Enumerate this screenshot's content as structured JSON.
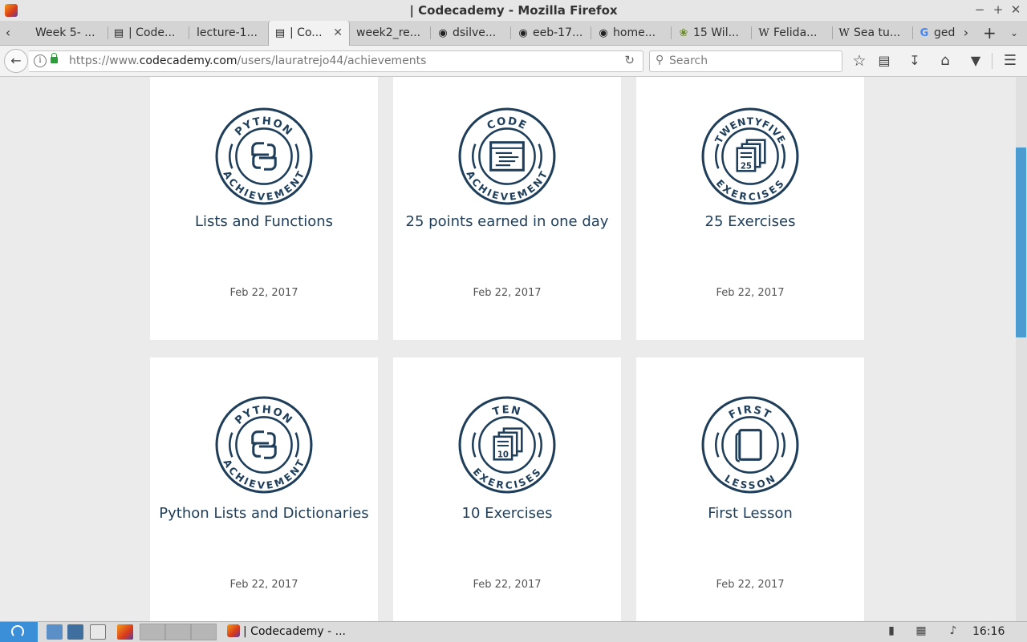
{
  "window": {
    "title": "| Codecademy - Mozilla Firefox"
  },
  "tabs": [
    {
      "label": "Week 5- ...",
      "favicon": "",
      "active": false
    },
    {
      "label": "| Code...",
      "favicon": "codecademy-icon",
      "active": false
    },
    {
      "label": "lecture-1...",
      "favicon": "",
      "active": false
    },
    {
      "label": "| Co...",
      "favicon": "codecademy-icon",
      "active": true
    },
    {
      "label": "week2_re...",
      "favicon": "",
      "active": false
    },
    {
      "label": "dsilve...",
      "favicon": "github-icon",
      "active": false
    },
    {
      "label": "eeb-17...",
      "favicon": "github-icon",
      "active": false
    },
    {
      "label": "home...",
      "favicon": "github-icon",
      "active": false
    },
    {
      "label": "15 Wil...",
      "favicon": "plant-icon",
      "active": false
    },
    {
      "label": "Felida...",
      "favicon": "wikipedia-icon",
      "active": false
    },
    {
      "label": "Sea tu...",
      "favicon": "wikipedia-icon",
      "active": false
    },
    {
      "label": "ged",
      "favicon": "google-icon",
      "active": false
    }
  ],
  "navbar": {
    "url_prefix": "https://www.",
    "url_domain": "codecademy.com",
    "url_path": "/users/lauratrejo44/achievements",
    "search_placeholder": "Search"
  },
  "achievements": [
    {
      "name": "Lists and Functions",
      "date": "Feb 22, 2017",
      "badge": "python",
      "badge_top": "PYTHON",
      "badge_bottom": "ACHIEVEMENT"
    },
    {
      "name": "25 points earned in one day",
      "date": "Feb 22, 2017",
      "badge": "code",
      "badge_top": "CODE",
      "badge_bottom": "ACHIEVEMENT"
    },
    {
      "name": "25 Exercises",
      "date": "Feb 22, 2017",
      "badge": "exercises",
      "badge_top": "TWENTYFIVE",
      "badge_bottom": "EXERCISES",
      "badge_number": "25"
    },
    {
      "name": "Python Lists and Dictionaries",
      "date": "Feb 22, 2017",
      "badge": "python",
      "badge_top": "PYTHON",
      "badge_bottom": "ACHIEVEMENT"
    },
    {
      "name": "10 Exercises",
      "date": "Feb 22, 2017",
      "badge": "exercises",
      "badge_top": "TEN",
      "badge_bottom": "EXERCISES",
      "badge_number": "10"
    },
    {
      "name": "First Lesson",
      "date": "Feb 22, 2017",
      "badge": "lesson",
      "badge_top": "FIRST",
      "badge_bottom": "LESSON"
    }
  ],
  "taskbar": {
    "active_app": "| Codecademy - ...",
    "clock": "16:16"
  },
  "colors": {
    "badge": "#1e3e5a",
    "scroll_thumb": "#4c9cd2",
    "start": "#3b8fd8"
  }
}
